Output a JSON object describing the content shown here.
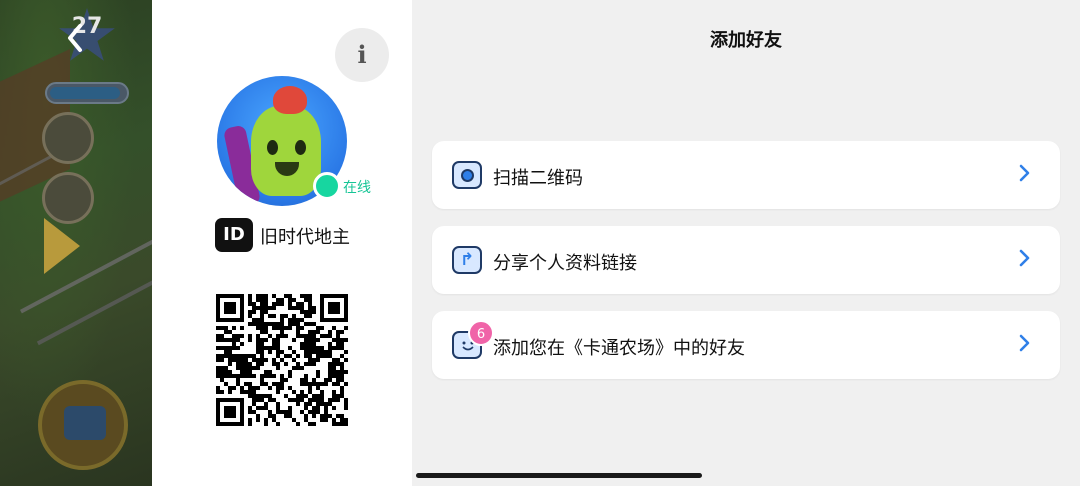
{
  "game": {
    "level": "27",
    "xp_progress": 0.95
  },
  "nav": {
    "back_icon": "chevron-left-icon"
  },
  "profile": {
    "info_label": "i",
    "status": "在线",
    "id_badge": "ID",
    "username": "旧时代地主"
  },
  "page": {
    "title": "添加好友"
  },
  "options": [
    {
      "label": "扫描二维码",
      "icon": "camera-scan-icon"
    },
    {
      "label": "分享个人资料链接",
      "icon": "share-icon"
    },
    {
      "label": "添加您在《卡通农场》中的好友",
      "icon": "farm-friend-icon",
      "badge": "6"
    }
  ],
  "colors": {
    "accent": "#2f7fe8",
    "online": "#17d6a0",
    "badge": "#f064a8"
  }
}
